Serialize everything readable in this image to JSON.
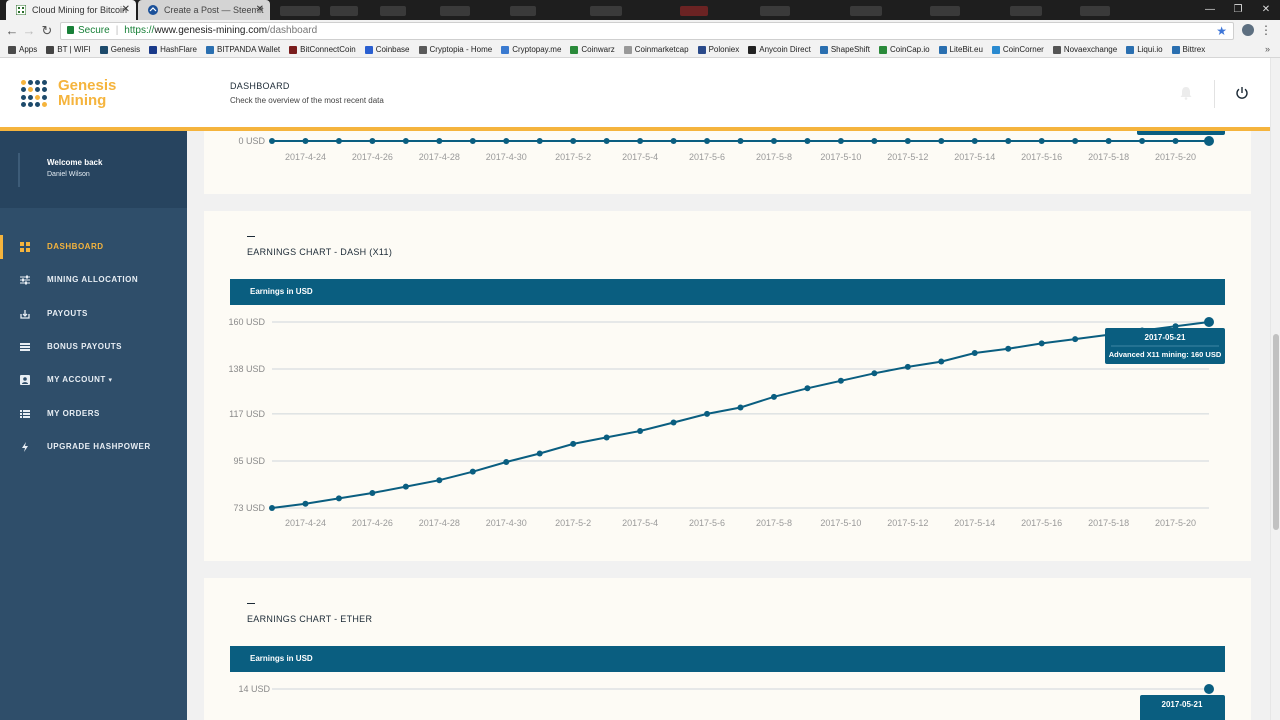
{
  "browser": {
    "tabs": [
      {
        "title": "Cloud Mining for Bitcoin",
        "active": true
      },
      {
        "title": "Create a Post — Steemit",
        "active": false
      }
    ],
    "url": {
      "secure_label": "Secure",
      "scheme": "https://",
      "host": "www.genesis-mining.com",
      "path": "/dashboard"
    },
    "bookmarks": [
      "Apps",
      "BT | WIFI",
      "Genesis",
      "HashFlare",
      "BITPANDA Wallet",
      "BitConnectCoin",
      "Coinbase",
      "Cryptopia - Home",
      "Cryptopay.me",
      "Coinwarz",
      "Coinmarketcap",
      "Poloniex",
      "Anycoin Direct",
      "ShapeShift",
      "CoinCap.io",
      "LiteBit.eu",
      "CoinCorner",
      "Novaexchange",
      "Liqui.io",
      "Bittrex"
    ]
  },
  "header": {
    "logo_line1": "Genesis",
    "logo_line2": "Mining",
    "title": "DASHBOARD",
    "subtitle": "Check the overview of the most recent data"
  },
  "sidebar": {
    "welcome": "Welcome back",
    "user": "Daniel Wilson",
    "items": [
      {
        "label": "DASHBOARD",
        "icon": "dashboard-icon",
        "active": true
      },
      {
        "label": "MINING ALLOCATION",
        "icon": "sliders-icon",
        "active": false
      },
      {
        "label": "PAYOUTS",
        "icon": "download-icon",
        "active": false
      },
      {
        "label": "BONUS PAYOUTS",
        "icon": "list-icon",
        "active": false
      },
      {
        "label": "MY ACCOUNT",
        "icon": "account-icon",
        "active": false,
        "dropdown": true
      },
      {
        "label": "MY ORDERS",
        "icon": "orders-icon",
        "active": false
      },
      {
        "label": "UPGRADE HASHPOWER",
        "icon": "bolt-icon",
        "active": false
      }
    ]
  },
  "colors": {
    "accent": "#f5b43d",
    "chart_line": "#0a5e80",
    "sidebar": "#2f4e6a",
    "band": "#0a5e80"
  },
  "dates": [
    "2017-4-24",
    "2017-4-26",
    "2017-4-28",
    "2017-4-30",
    "2017-5-2",
    "2017-5-4",
    "2017-5-6",
    "2017-5-8",
    "2017-5-10",
    "2017-5-12",
    "2017-5-14",
    "2017-5-16",
    "2017-5-18",
    "2017-5-20"
  ],
  "chart_data": [
    {
      "type": "line",
      "title": "",
      "ytick_labels": [
        "0 USD"
      ],
      "ylim": [
        0,
        1
      ],
      "points": 29,
      "values": [
        0,
        0,
        0,
        0,
        0,
        0,
        0,
        0,
        0,
        0,
        0,
        0,
        0,
        0,
        0,
        0,
        0,
        0,
        0,
        0,
        0,
        0,
        0,
        0,
        0,
        0,
        0,
        0,
        0
      ]
    },
    {
      "type": "line",
      "title": "EARNINGS CHART - DASH (X11)",
      "band_label": "Earnings in USD",
      "ylim": [
        73,
        160
      ],
      "yticks": [
        73,
        95,
        117,
        138,
        160
      ],
      "ytick_labels": [
        "73 USD",
        "95 USD",
        "117 USD",
        "138 USD",
        "160 USD"
      ],
      "series": [
        {
          "name": "Advanced X11 mining",
          "values": [
            73,
            75,
            77.5,
            80,
            83,
            86,
            90,
            94.5,
            98.5,
            103,
            106,
            109,
            113,
            117,
            120,
            125,
            129,
            132.5,
            136,
            139,
            141.5,
            145.5,
            147.5,
            150,
            152,
            154,
            156,
            158,
            160
          ]
        }
      ],
      "tooltip": {
        "date": "2017-05-21",
        "label": "Advanced X11 mining: 160 USD"
      }
    },
    {
      "type": "line",
      "title": "EARNINGS CHART - ETHER",
      "band_label": "Earnings in USD",
      "ytick_labels": [
        "14 USD"
      ],
      "ylim": [
        0,
        14
      ],
      "values": [
        14
      ],
      "tooltip": {
        "date": "2017-05-21"
      }
    }
  ]
}
